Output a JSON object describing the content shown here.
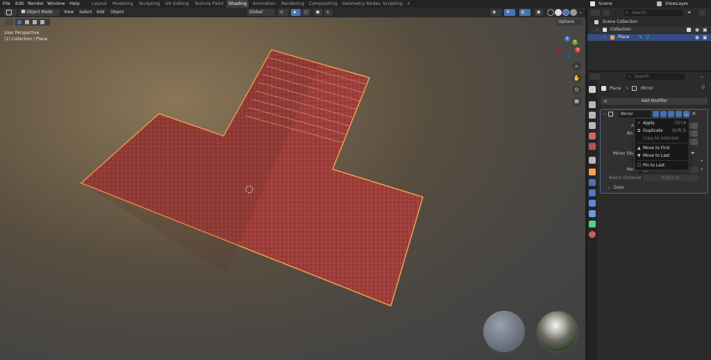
{
  "top_menu": [
    "File",
    "Edit",
    "Render",
    "Window",
    "Help"
  ],
  "workspaces": [
    "Layout",
    "Modeling",
    "Sculpting",
    "UV Editing",
    "Texture Paint",
    "Shading",
    "Animation",
    "Rendering",
    "Compositing",
    "Geometry Nodes",
    "Scripting"
  ],
  "active_workspace": "Shading",
  "add_workspace": "+",
  "scene": {
    "label": "Scene"
  },
  "view_layer": {
    "label": "ViewLayer"
  },
  "viewport_header": {
    "mode": "Object Mode",
    "menus": [
      "View",
      "Select",
      "Add",
      "Object"
    ],
    "transform": "Global",
    "options": "Options"
  },
  "overlay_text": {
    "line1": "User Perspective",
    "line2": "(1) Collection | Plane"
  },
  "gizmo": {
    "z": "Z",
    "y": "Y",
    "x": "X"
  },
  "outliner": {
    "search_placeholder": "Search",
    "items": [
      {
        "label": "Scene Collection"
      },
      {
        "label": "Collection"
      },
      {
        "label": "Plane"
      }
    ]
  },
  "properties": {
    "search_placeholder": "Search",
    "breadcrumb_object": "Plane",
    "breadcrumb_sep": ">",
    "breadcrumb_modifier": "Mirror",
    "add_modifier": "Add Modifier",
    "modifier_name": "Mirror",
    "mirror_object_label": "Mirror Obj",
    "merge_label": "Merg",
    "bisect_distance_label": "Bisect Distance",
    "bisect_distance_value": "0.001 m",
    "axis_label": "A",
    "bisect_label": "Bis",
    "data_label": "Data"
  },
  "dropdown": {
    "items": [
      {
        "label": "Apply",
        "shortcut": "Ctrl A",
        "disabled": false
      },
      {
        "label": "Duplicate",
        "shortcut": "Shift D",
        "disabled": false
      },
      {
        "label": "Copy to Selected",
        "shortcut": "",
        "disabled": true
      },
      {
        "label": "Move to First",
        "shortcut": "",
        "disabled": false
      },
      {
        "label": "Move to Last",
        "shortcut": "",
        "disabled": false
      },
      {
        "label": "Pin to Last",
        "shortcut": "",
        "disabled": false
      }
    ]
  },
  "colors": {
    "accent": "#4772b3",
    "selection": "#f6a24a",
    "plane": "#9a3a36"
  }
}
